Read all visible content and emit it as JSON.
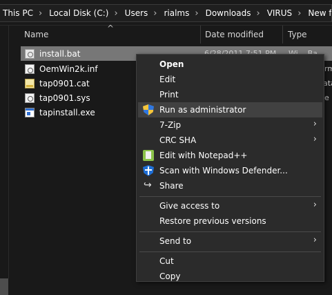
{
  "breadcrumb": {
    "items": [
      "This PC",
      "Local Disk (C:)",
      "Users",
      "rialms",
      "Downloads",
      "VIRUS",
      "New folder"
    ],
    "separator": "›"
  },
  "columns": {
    "name": "Name",
    "date_modified": "Date modified",
    "type": "Type"
  },
  "files": [
    {
      "name": "install.bat",
      "icon": "batch-file-icon",
      "date_partial": "6/28/2011 7:51 PM",
      "type_partial": "Wi... Ba",
      "selected": true
    },
    {
      "name": "OemWin2k.inf",
      "icon": "setup-info-file-icon",
      "type_partial": "rm"
    },
    {
      "name": "tap0901.cat",
      "icon": "security-catalog-icon",
      "type_partial": "ata"
    },
    {
      "name": "tap0901.sys",
      "icon": "system-file-icon",
      "type_partial": "e"
    },
    {
      "name": "tapinstall.exe",
      "icon": "application-icon",
      "type_partial": ""
    }
  ],
  "context_menu": {
    "items": [
      {
        "label": "Open",
        "bold": true
      },
      {
        "label": "Edit"
      },
      {
        "label": "Print"
      },
      {
        "label": "Run as administrator",
        "icon": "uac-shield-icon",
        "hover": true
      },
      {
        "label": "7-Zip",
        "submenu": true
      },
      {
        "label": "CRC SHA",
        "submenu": true
      },
      {
        "label": "Edit with Notepad++",
        "icon": "notepad-plus-plus-icon"
      },
      {
        "label": "Scan with Windows Defender...",
        "icon": "windows-defender-icon"
      },
      {
        "label": "Share",
        "icon": "share-icon"
      },
      {
        "label": "Give access to",
        "submenu": true
      },
      {
        "label": "Restore previous versions"
      },
      {
        "label": "Send to",
        "submenu": true
      },
      {
        "label": "Cut"
      },
      {
        "label": "Copy"
      }
    ],
    "submenu_arrow": "›"
  },
  "colors": {
    "background": "#191919",
    "menu_background": "#2b2b2b",
    "selection": "#777777",
    "menu_hover": "#414141"
  }
}
